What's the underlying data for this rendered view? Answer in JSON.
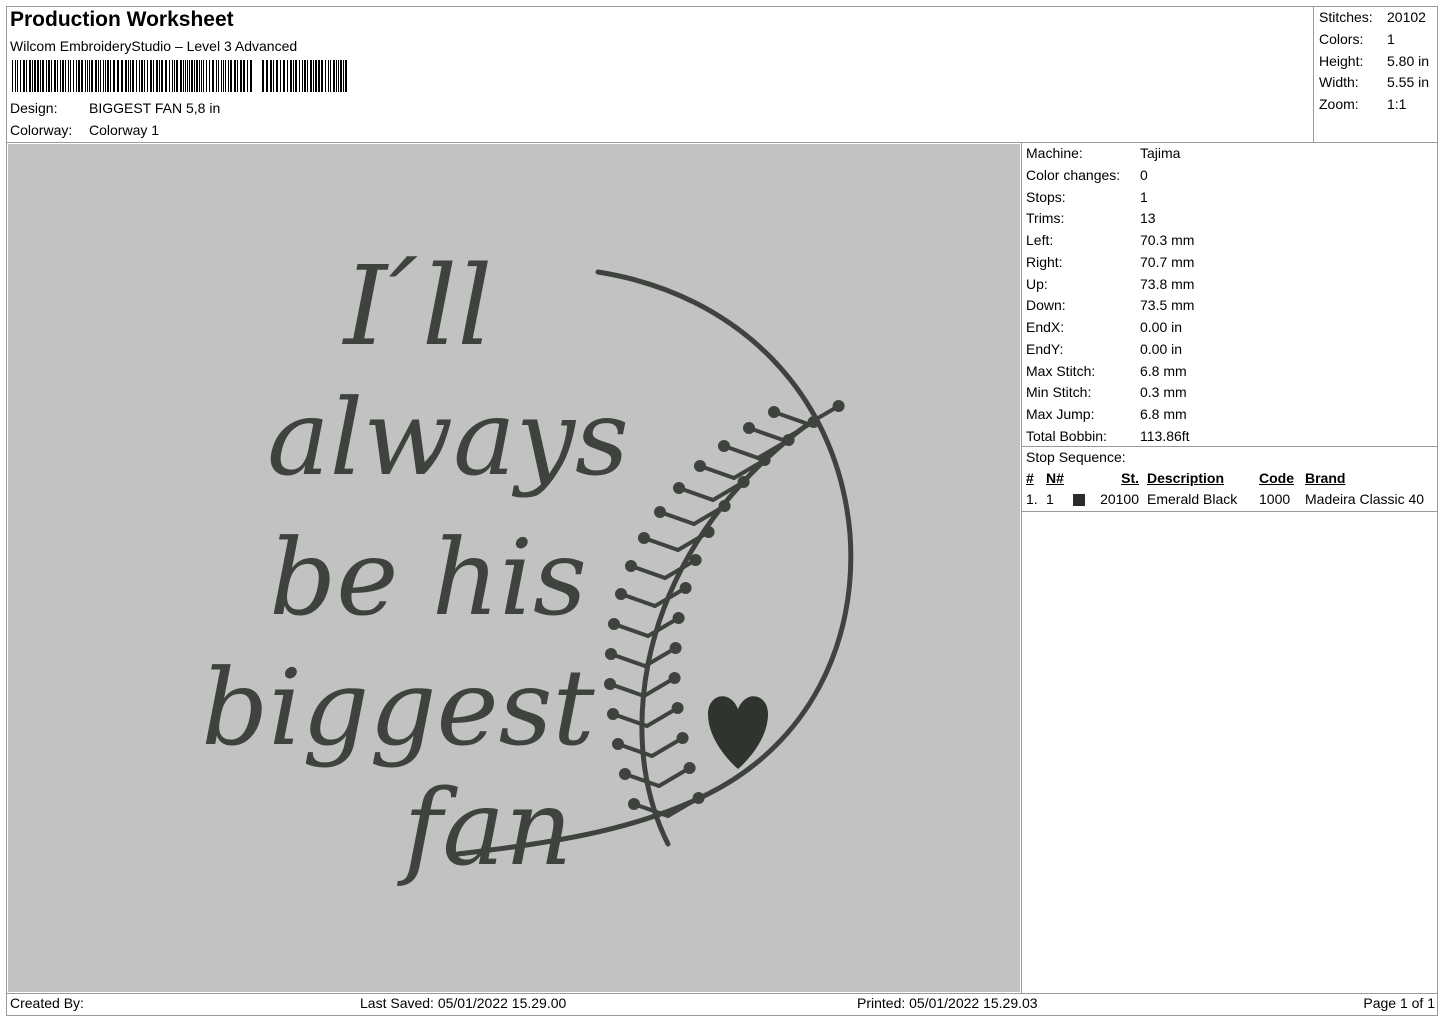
{
  "header": {
    "title": "Production Worksheet",
    "software": "Wilcom EmbroideryStudio – Level 3 Advanced",
    "design_label": "Design:",
    "design_value": "BIGGEST FAN 5,8 in",
    "colorway_label": "Colorway:",
    "colorway_value": "Colorway 1"
  },
  "stats": [
    {
      "label": "Stitches:",
      "value": "20102"
    },
    {
      "label": "Colors:",
      "value": "1"
    },
    {
      "label": "Height:",
      "value": "5.80 in"
    },
    {
      "label": "Width:",
      "value": "5.55 in"
    },
    {
      "label": "Zoom:",
      "value": "1:1"
    }
  ],
  "machine_info": [
    {
      "label": "Machine:",
      "value": "Tajima"
    },
    {
      "label": "Color changes:",
      "value": "0"
    },
    {
      "label": "Stops:",
      "value": "1"
    },
    {
      "label": "Trims:",
      "value": "13"
    },
    {
      "label": "Left:",
      "value": "70.3 mm"
    },
    {
      "label": "Right:",
      "value": "70.7 mm"
    },
    {
      "label": "Up:",
      "value": "73.8 mm"
    },
    {
      "label": "Down:",
      "value": "73.5 mm"
    },
    {
      "label": "EndX:",
      "value": "0.00 in"
    },
    {
      "label": "EndY:",
      "value": "0.00 in"
    },
    {
      "label": "Max Stitch:",
      "value": "6.8 mm"
    },
    {
      "label": "Min Stitch:",
      "value": "0.3 mm"
    },
    {
      "label": "Max Jump:",
      "value": "6.8 mm"
    },
    {
      "label": "Total Bobbin:",
      "value": "113.86ft"
    }
  ],
  "stop_sequence": {
    "title": "Stop Sequence:",
    "headers": {
      "num": "#",
      "n": "N#",
      "st": "St.",
      "description": "Description",
      "code": "Code",
      "brand": "Brand"
    },
    "rows": [
      {
        "num": "1.",
        "n": "1",
        "st": "20100",
        "description": "Emerald Black",
        "code": "1000",
        "brand": "Madeira Classic 40",
        "swatch_color": "#2b2b2b"
      }
    ]
  },
  "design_preview": {
    "lines": [
      "I ́ll",
      "always",
      "be his",
      "biggest",
      "fan"
    ],
    "thread_color": "#3e433e",
    "background_color": "#c2c2c2"
  },
  "footer": {
    "created_by": "Created By:",
    "last_saved": "Last Saved: 05/01/2022 15.29.00",
    "printed": "Printed: 05/01/2022 15.29.03",
    "page": "Page 1 of 1"
  }
}
